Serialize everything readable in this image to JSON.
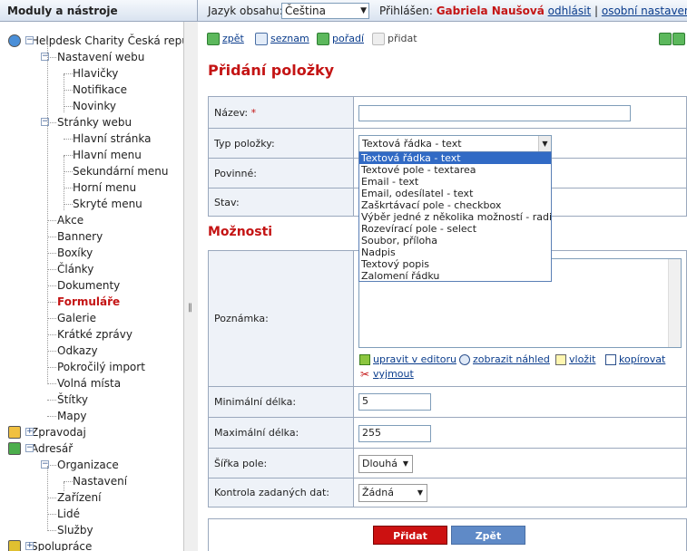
{
  "sidebar": {
    "title": "Moduly a nástroje",
    "tree": [
      {
        "label": "Helpdesk Charity Česká repub",
        "level": 0,
        "toggle": "−",
        "icon": "globe-icon"
      },
      {
        "label": "Nastavení webu",
        "level": 1,
        "toggle": "−"
      },
      {
        "label": "Hlavičky",
        "level": 2
      },
      {
        "label": "Notifikace",
        "level": 2
      },
      {
        "label": "Novinky",
        "level": 2
      },
      {
        "label": "Stránky webu",
        "level": 1,
        "toggle": "−"
      },
      {
        "label": "Hlavní stránka",
        "level": 2
      },
      {
        "label": "Hlavní menu",
        "level": 2
      },
      {
        "label": "Sekundární menu",
        "level": 2
      },
      {
        "label": "Horní menu",
        "level": 2
      },
      {
        "label": "Skryté menu",
        "level": 2
      },
      {
        "label": "Akce",
        "level": 1
      },
      {
        "label": "Bannery",
        "level": 1
      },
      {
        "label": "Boxíky",
        "level": 1
      },
      {
        "label": "Články",
        "level": 1
      },
      {
        "label": "Dokumenty",
        "level": 1
      },
      {
        "label": "Formuláře",
        "level": 1,
        "active": true
      },
      {
        "label": "Galerie",
        "level": 1
      },
      {
        "label": "Krátké zprávy",
        "level": 1
      },
      {
        "label": "Odkazy",
        "level": 1
      },
      {
        "label": "Pokročilý import",
        "level": 1
      },
      {
        "label": "Volná místa",
        "level": 1
      },
      {
        "label": "Štítky",
        "level": 1
      },
      {
        "label": "Mapy",
        "level": 1
      },
      {
        "label": "Zpravodaj",
        "level": 0,
        "toggle": "+",
        "icon": "envelope-icon"
      },
      {
        "label": "Adresář",
        "level": 0,
        "toggle": "−",
        "icon": "database-icon"
      },
      {
        "label": "Organizace",
        "level": 1,
        "toggle": "−"
      },
      {
        "label": "Nastavení",
        "level": 2
      },
      {
        "label": "Zařízení",
        "level": 1
      },
      {
        "label": "Lidé",
        "level": 1
      },
      {
        "label": "Služby",
        "level": 1
      },
      {
        "label": "Spolupráce",
        "level": 0,
        "toggle": "+",
        "icon": "puzzle-icon"
      }
    ]
  },
  "topbar": {
    "lang_label": "Jazyk obsahu:",
    "lang_value": "Čeština",
    "login_label": "Přihlášen:",
    "user_name": "Gabriela Naušová",
    "logout": "odhlásit",
    "sep": "|",
    "settings": "osobní nastavení"
  },
  "toolbar": {
    "back": "zpět",
    "list": "seznam",
    "order": "pořadí",
    "add": "přidat"
  },
  "page": {
    "title": "Přidání položky",
    "section_options": "Možnosti"
  },
  "form": {
    "name_label": "Název:",
    "name_req": "*",
    "name_value": "",
    "type_label": "Typ položky:",
    "type_value": "Textová řádka - text",
    "required_label": "Povinné:",
    "state_label": "Stav:",
    "type_options": [
      "Textová řádka - text",
      "Textové pole - textarea",
      "Email - text",
      "Email, odesílatel - text",
      "Zaškrtávací pole - checkbox",
      "Výběr jedné z několika možností - radio",
      "Rozevírací pole - select",
      "Soubor, příloha",
      "Nadpis",
      "Textový popis",
      "Zalomení řádku"
    ],
    "note_label": "Poznámka:",
    "editor_links": {
      "edit": "upravit v editoru",
      "preview": "zobrazit náhled",
      "insert": "vložit",
      "copy": "kopírovat",
      "cut": "vyjmout"
    },
    "min_label": "Minimální délka:",
    "min_value": "5",
    "max_label": "Maximální délka:",
    "max_value": "255",
    "width_label": "Šířka pole:",
    "width_value": "Dlouhá",
    "check_label": "Kontrola zadaných dat:",
    "check_value": "Žádná"
  },
  "buttons": {
    "submit": "Přidat",
    "back": "Zpět"
  },
  "colors": {
    "accent_red": "#c41414",
    "link": "#0a3c8c",
    "submit_bg": "#cc1111",
    "back_bg": "#5f8ac7",
    "selection": "#316ac5"
  }
}
